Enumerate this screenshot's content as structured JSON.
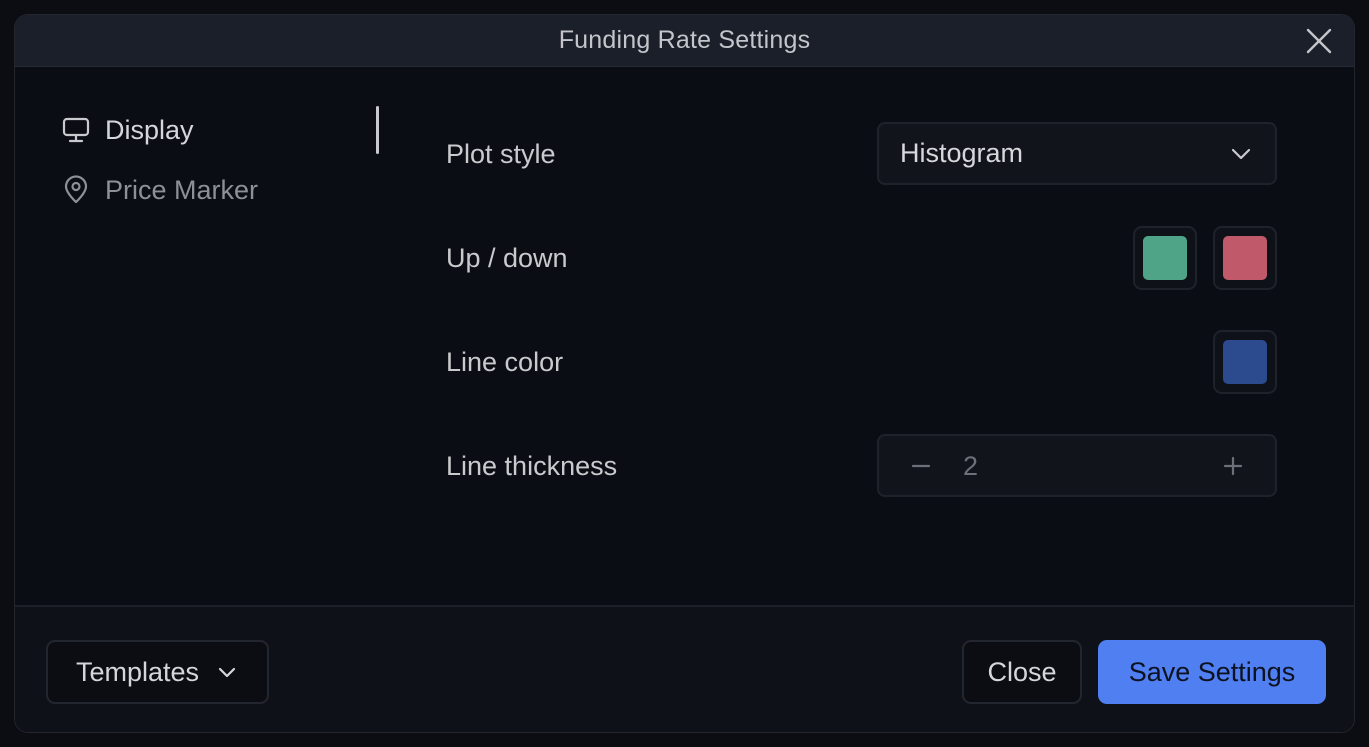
{
  "dialog": {
    "title": "Funding Rate Settings"
  },
  "sidebar": {
    "items": [
      {
        "label": "Display",
        "icon": "monitor-icon",
        "active": true
      },
      {
        "label": "Price Marker",
        "icon": "map-pin-icon",
        "active": false
      }
    ]
  },
  "settings": {
    "plot_style": {
      "label": "Plot style",
      "value": "Histogram"
    },
    "up_down": {
      "label": "Up / down",
      "up_color": "#4fa487",
      "down_color": "#c0596a"
    },
    "line_color": {
      "label": "Line color",
      "color": "#2c4a8e"
    },
    "line_thickness": {
      "label": "Line thickness",
      "value": "2",
      "decrement_symbol": "−",
      "increment_symbol": "+"
    }
  },
  "footer": {
    "templates_label": "Templates",
    "close_label": "Close",
    "save_label": "Save Settings"
  },
  "colors": {
    "accent": "#4f7ff0",
    "background": "#0b0d14",
    "titlebar": "#1b1f29"
  }
}
